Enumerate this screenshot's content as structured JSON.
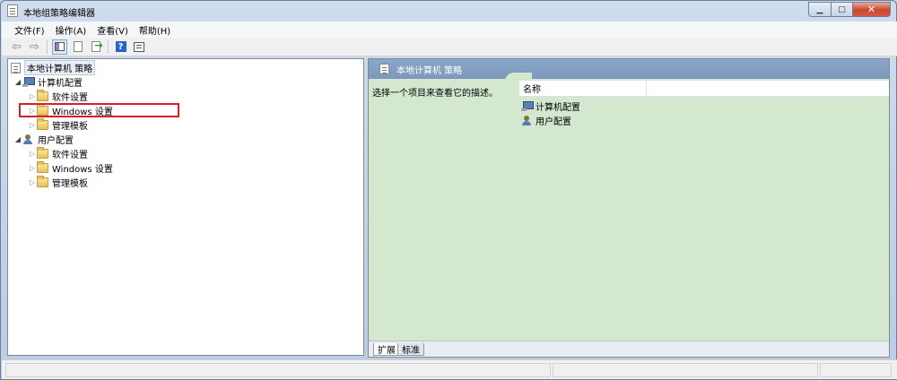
{
  "window": {
    "title": "本地组策略编辑器"
  },
  "menu": [
    "文件(F)",
    "操作(A)",
    "查看(V)",
    "帮助(H)"
  ],
  "tree": {
    "root": "本地计算机 策略",
    "computer_config": "计算机配置",
    "computer_children": [
      "软件设置",
      "Windows 设置",
      "管理模板"
    ],
    "user_config": "用户配置",
    "user_children": [
      "软件设置",
      "Windows 设置",
      "管理模板"
    ]
  },
  "right": {
    "header_title": "本地计算机 策略",
    "description": "选择一个项目来查看它的描述。",
    "column_name": "名称",
    "items": [
      "计算机配置",
      "用户配置"
    ],
    "tabs": [
      "扩展",
      "标准"
    ]
  },
  "colors": {
    "selection_border": "#d3222a",
    "right_bg": "#d3e8cf",
    "header_bg": "#7c99bd"
  }
}
